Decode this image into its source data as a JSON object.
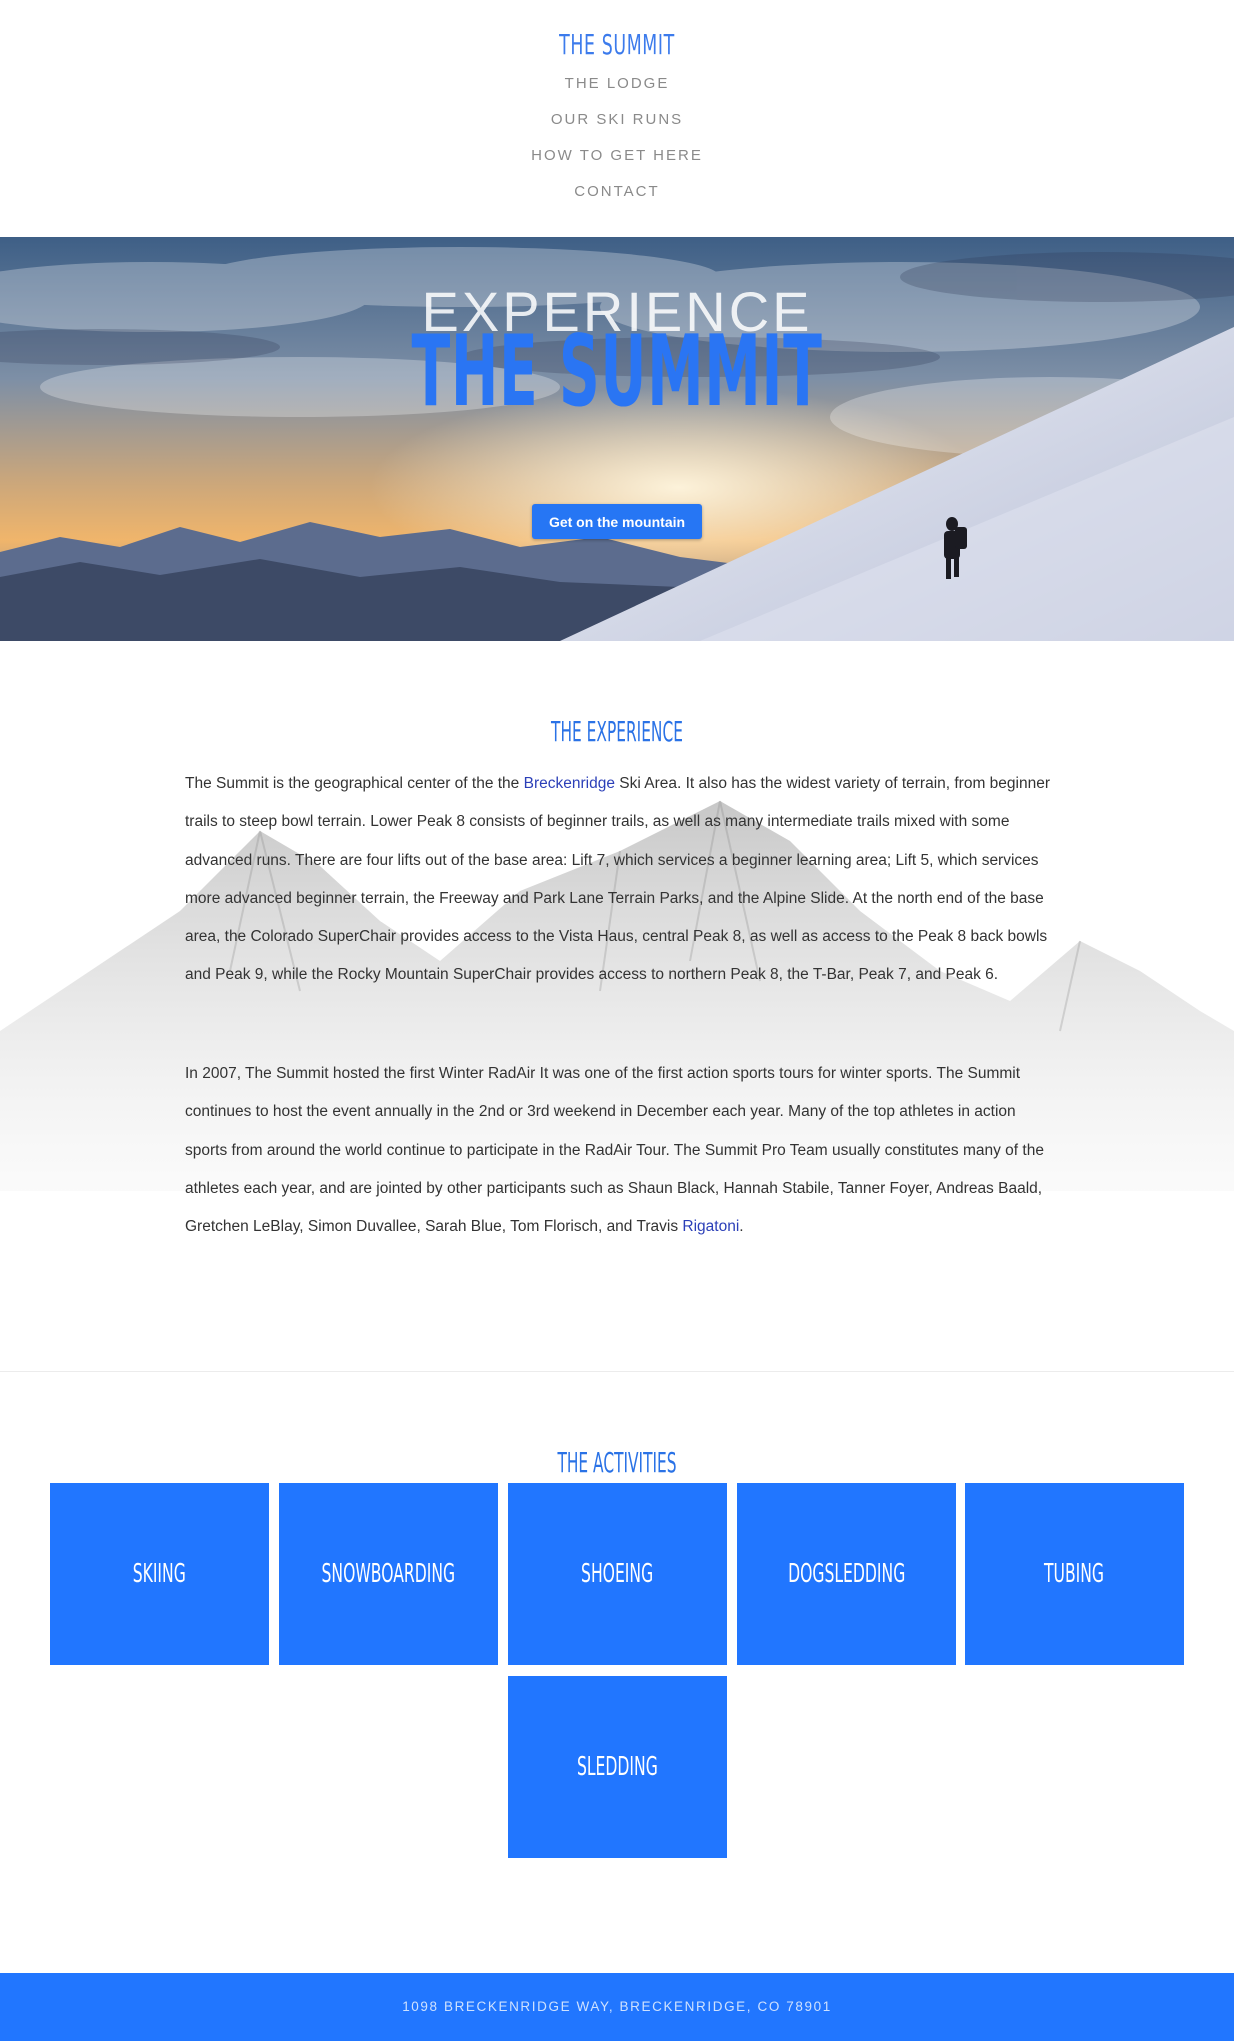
{
  "header": {
    "brand": "THE SUMMIT",
    "nav": [
      {
        "label": "THE LODGE"
      },
      {
        "label": "OUR SKI RUNS"
      },
      {
        "label": "HOW TO GET HERE"
      },
      {
        "label": "CONTACT"
      }
    ]
  },
  "hero": {
    "pre_title": "EXPERIENCE",
    "title": "THE SUMMIT",
    "button_label": "Get on the mountain"
  },
  "experience": {
    "title": "THE EXPERIENCE",
    "p1": {
      "before": "The Summit is the geographical center of the the ",
      "link": "Breckenridge",
      "after": " Ski Area. It also has the widest variety of terrain, from beginner trails to steep bowl terrain. Lower Peak 8 consists of beginner trails, as well as many intermediate trails mixed with some advanced runs. There are four lifts out of the base area: Lift 7, which services a beginner learning area; Lift 5, which services more advanced beginner terrain, the Freeway and Park Lane Terrain Parks, and the Alpine Slide. At the north end of the base area, the Colorado SuperChair provides access to the Vista Haus, central Peak 8, as well as access to the Peak 8 back bowls and Peak 9, while the Rocky Mountain SuperChair provides access to northern Peak 8, the T-Bar, Peak 7, and Peak 6."
    },
    "p2": {
      "before": "In 2007, The Summit hosted the first Winter RadAir It was one of the first action sports tours for winter sports. The Summit continues to host the event annually in the 2nd or 3rd weekend in December each year. Many of the top athletes in action sports from around the world continue to participate in the RadAir Tour. The Summit Pro Team usually constitutes many of the athletes each year, and are jointed by other participants such as Shaun Black, Hannah Stabile, Tanner Foyer, Andreas Baald, Gretchen LeBlay, Simon Duvallee, Sarah Blue, Tom Florisch, and Travis ",
      "link": "Rigatoni",
      "after": "."
    }
  },
  "activities": {
    "title": "THE ACTIVITIES",
    "items": [
      {
        "label": "SKIING"
      },
      {
        "label": "SNOWBOARDING"
      },
      {
        "label": "SHOEING"
      },
      {
        "label": "DOGSLEDDING"
      },
      {
        "label": "TUBING"
      },
      {
        "label": "SLEDDING"
      }
    ]
  },
  "footer": {
    "address": "1098 BRECKENRIDGE WAY, BRECKENRIDGE, CO 78901"
  },
  "colors": {
    "accent": "#2176ff",
    "link": "#2b3fb8",
    "nav_text": "#8a8a8a"
  }
}
